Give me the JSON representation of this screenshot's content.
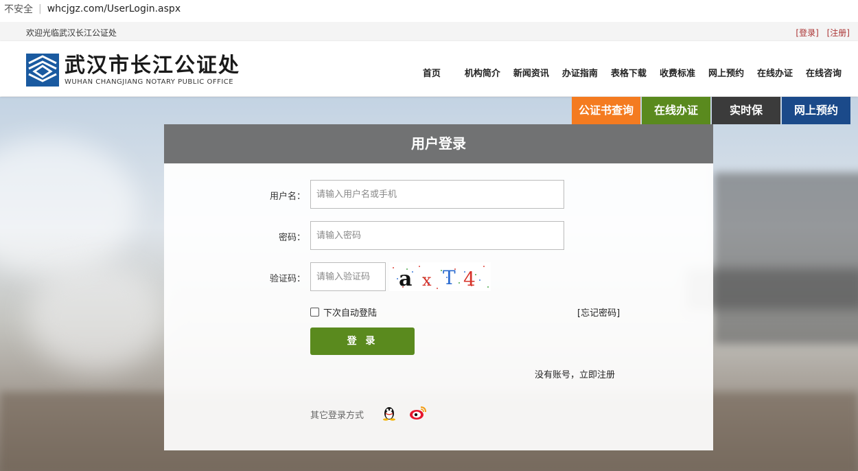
{
  "browser": {
    "security": "不安全",
    "url": "whcjgz.com/UserLogin.aspx"
  },
  "topbar": {
    "welcome": "欢迎光临武汉长江公证处",
    "login_link": "[登录]",
    "register_link": "[注册]"
  },
  "logo": {
    "cn": "武汉市长江公证处",
    "en": "WUHAN CHANGJIANG NOTARY PUBLIC OFFICE"
  },
  "nav": [
    "首页",
    "机构简介",
    "新闻资讯",
    "办证指南",
    "表格下载",
    "收费标准",
    "网上预约",
    "在线办证",
    "在线咨询"
  ],
  "quick_links": [
    "公证书查询",
    "在线办证",
    "实时保",
    "网上预约"
  ],
  "form": {
    "title": "用户登录",
    "username_label": "用户名：",
    "username_placeholder": "请输入用户名或手机",
    "password_label": "密码：",
    "password_placeholder": "请输入密码",
    "captcha_label": "验证码：",
    "captcha_placeholder": "请输入验证码",
    "captcha_text": "axT4",
    "remember_label": "下次自动登陆",
    "forgot_label": "[忘记密码]",
    "login_button": "登 录",
    "register_text": "没有账号，立即注册",
    "other_login": "其它登录方式"
  },
  "colors": {
    "orange": "#f47b20",
    "green": "#5a8a1e",
    "dark": "#3b3b3b",
    "blue": "#1b4a8a",
    "title_bar": "#717273"
  }
}
